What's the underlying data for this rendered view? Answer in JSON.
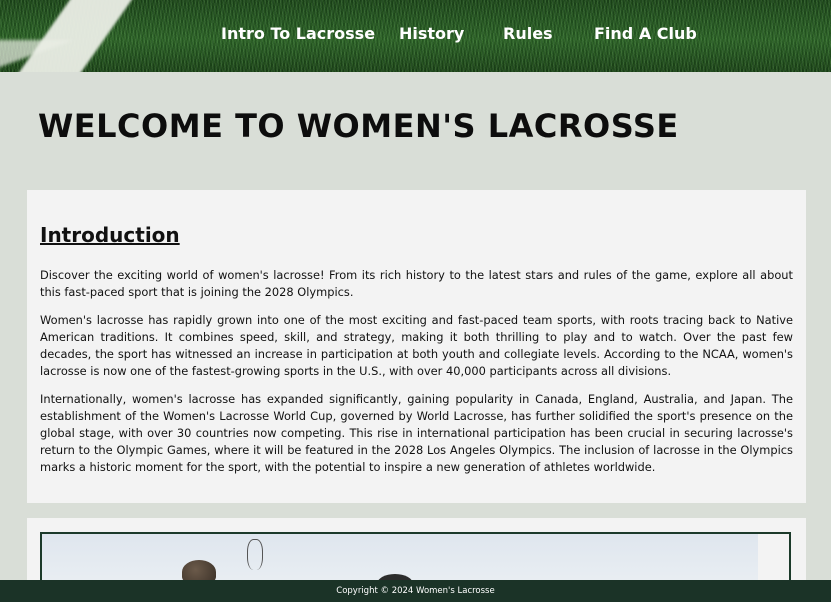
{
  "nav": {
    "items": [
      {
        "label": "Intro To Lacrosse"
      },
      {
        "label": "History"
      },
      {
        "label": "Rules"
      },
      {
        "label": "Find A Club"
      }
    ]
  },
  "page": {
    "title": "WELCOME TO WOMEN'S LACROSSE"
  },
  "intro": {
    "heading": "Introduction",
    "paragraphs": [
      "Discover the exciting world of women's lacrosse! From its rich history to the latest stars and rules of the game, explore all about this fast-paced sport that is joining the 2028 Olympics.",
      "Women's lacrosse has rapidly grown into one of the most exciting and fast-paced team sports, with roots tracing back to Native American traditions. It combines speed, skill, and strategy, making it both thrilling to play and to watch. Over the past few decades, the sport has witnessed an increase in participation at both youth and collegiate levels. According to the NCAA, women's lacrosse is now one of the fastest-growing sports in the U.S., with over 40,000 participants across all divisions.",
      "Internationally, women's lacrosse has expanded significantly, gaining popularity in Canada, England, Australia, and Japan. The establishment of the Women's Lacrosse World Cup, governed by World Lacrosse, has further solidified the sport's presence on the global stage, with over 30 countries now competing. This rise in international participation has been crucial in securing lacrosse's return to the Olympic Games, where it will be featured in the 2028 Los Angeles Olympics. The inclusion of lacrosse in the Olympics marks a historic moment for the sport, with the potential to inspire a new generation of athletes worldwide."
    ]
  },
  "footer": {
    "copyright": "Copyright © 2024 Women's Lacrosse"
  },
  "colors": {
    "background": "#d9ded7",
    "footer": "#1b3327",
    "card": "#f3f3f3"
  }
}
